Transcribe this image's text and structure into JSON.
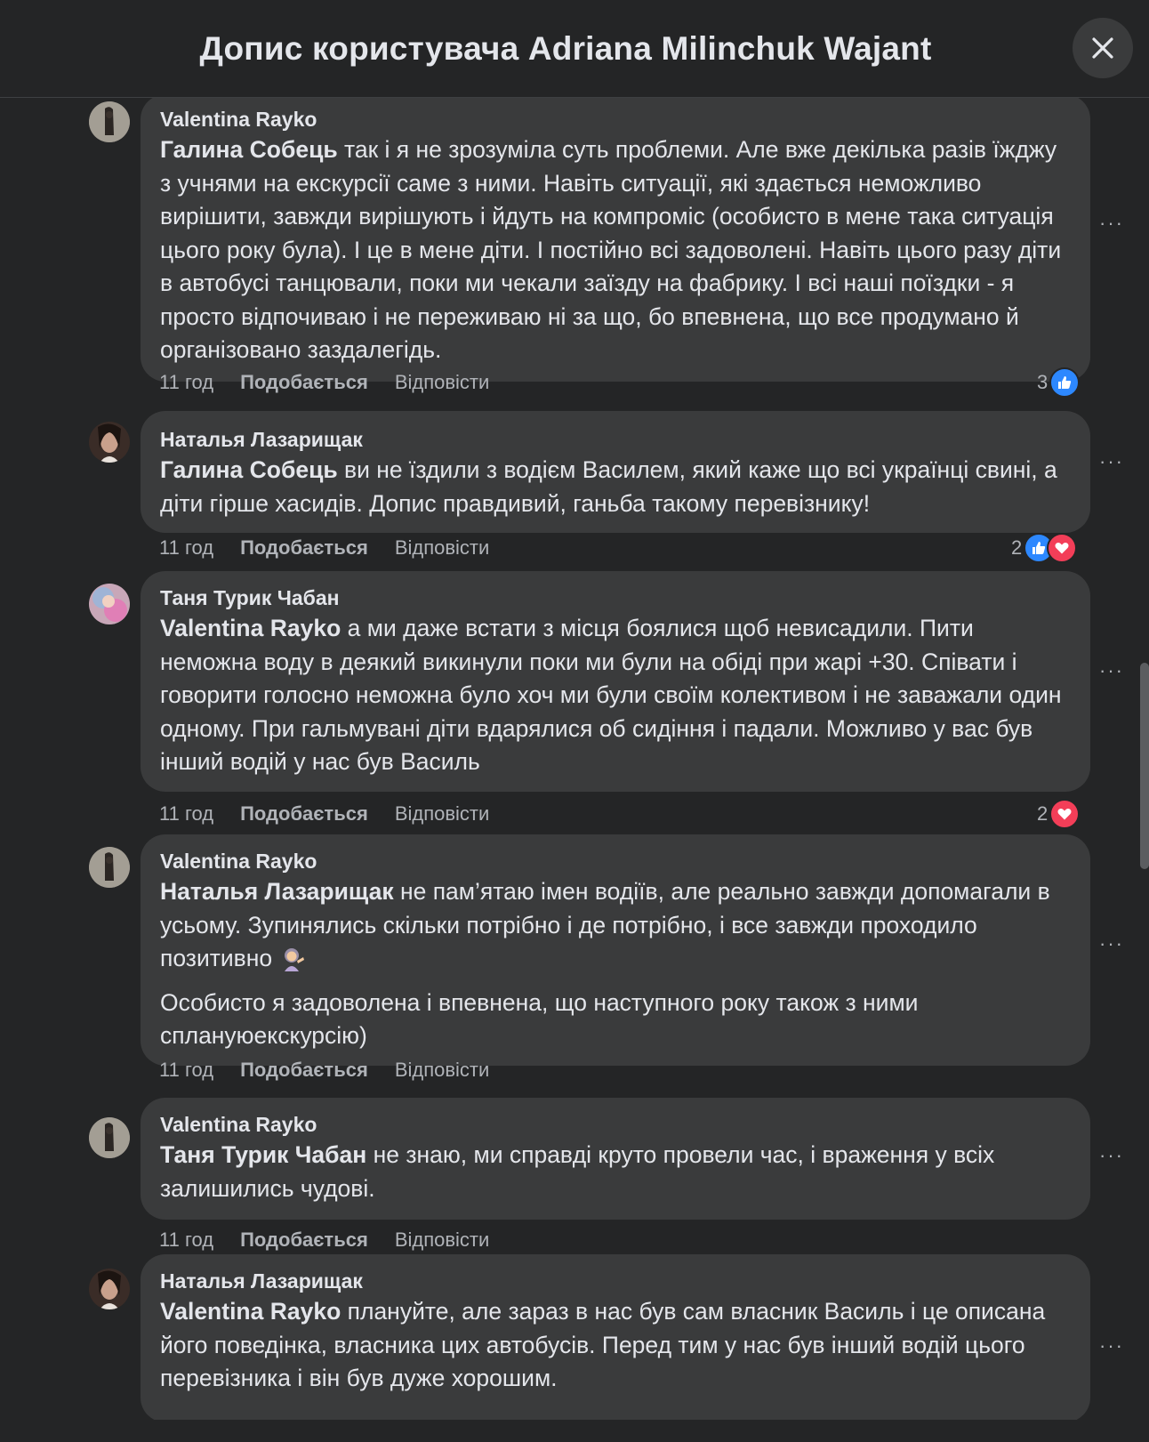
{
  "header": {
    "title": "Допис користувача Adriana Milinchuk Wajant",
    "close_icon": "close-icon"
  },
  "labels": {
    "like": "Подобається",
    "reply": "Відповісти",
    "more": "···"
  },
  "comments": [
    {
      "author": "Valentina Rayko",
      "mention": "Галина Собець",
      "text": " так і я не зрозуміла суть проблеми. Але вже декілька разів їжджу з учнями на екскурсії саме з ними. Навіть ситуації, які здається неможливо вирішити, завжди вирішують і йдуть на компроміс (особисто в мене така ситуація цього року була). І це в мене діти. І постійно всі задоволені. Навіть цього разу діти в автобусі танцювали, поки ми чекали заїзду на фабрику. І всі наші поїздки - я просто відпочиваю і не переживаю ні за що, бо впевнена, що все продумано й організовано заздалегідь.",
      "time": "11 год",
      "reaction_count": "3",
      "reactions": [
        "like"
      ]
    },
    {
      "author": "Наталья Лазарищак",
      "mention": "Галина Собець",
      "text": " ви не їздили з водієм Василем, який каже що всі українці свині, а діти гірше хасидів. Допис правдивий, ганьба такому перевізнику!",
      "time": "11 год",
      "reaction_count": "2",
      "reactions": [
        "like",
        "love"
      ]
    },
    {
      "author": "Таня Турик Чабан",
      "mention": "Valentina Rayko",
      "text": " а ми даже встати з місця боялися щоб невисадили. Пити неможна воду в деякий викинули поки ми були на обіді при жарі +30. Співати і говорити голосно неможна було хоч ми були своїм колективом і не заважали один одному. При гальмувані діти вдарялися об сидіння і падали. Можливо у вас був інший водій у нас був Василь",
      "time": "11 год",
      "reaction_count": "2",
      "reactions": [
        "love"
      ]
    },
    {
      "author": "Valentina Rayko",
      "mention": "Наталья Лазарищак",
      "text": " не пам’ятаю імен водіїв, але реально завжди допомагали в усьому. Зупинялись скільки потрібно і де потрібно, і все завжди проходило позитивно",
      "text2": "Особисто я задоволена і впевнена, що наступного року також з ними сплануюекскурсію)",
      "time": "11 год"
    },
    {
      "author": "Valentina Rayko",
      "mention": "Таня Турик Чабан",
      "text": " не знаю, ми справді круто провели час, і враження у всіх залишились чудові.",
      "time": "11 год"
    },
    {
      "author": "Наталья Лазарищак",
      "mention": "Valentina Rayko",
      "text": " плануйте, але зараз в нас був сам власник Василь і це описана його поведінка, власника цих автобусів. Перед тим у нас був інший водій цього перевізника і він був дуже хорошим."
    }
  ]
}
